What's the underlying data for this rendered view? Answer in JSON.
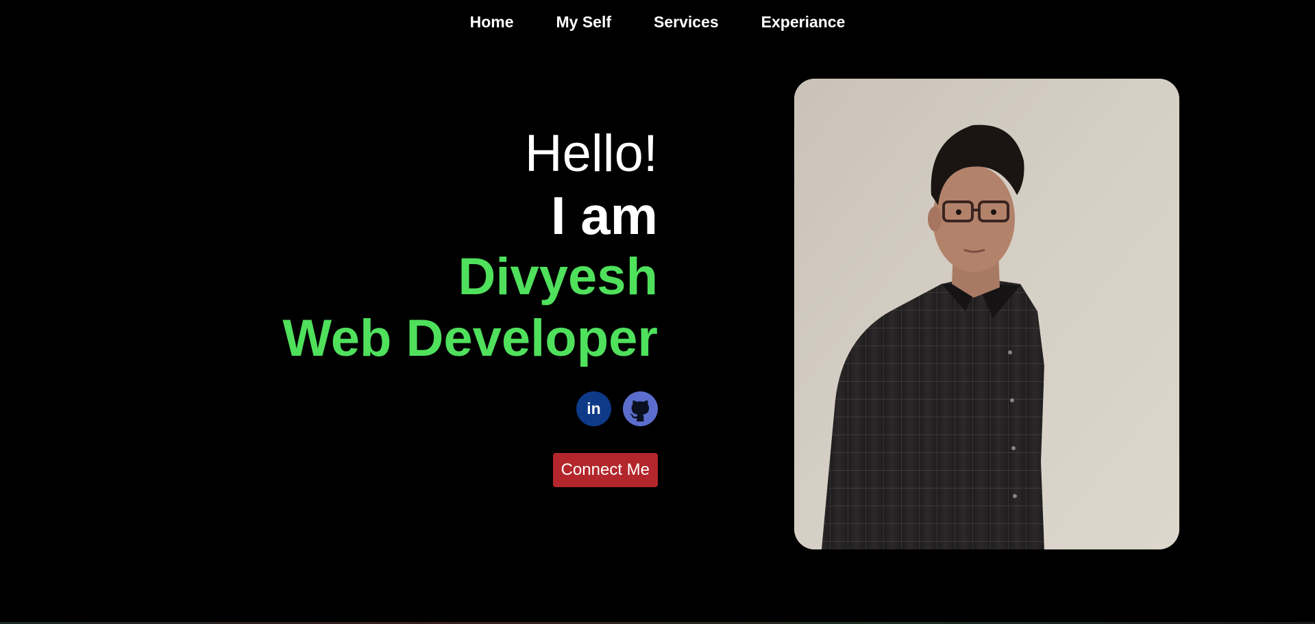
{
  "nav": {
    "items": [
      {
        "label": "Home"
      },
      {
        "label": "My Self"
      },
      {
        "label": "Services"
      },
      {
        "label": "Experiance"
      }
    ]
  },
  "hero": {
    "greeting": "Hello!",
    "intro": "I am",
    "name": "Divyesh",
    "role": "Web Developer"
  },
  "socials": [
    {
      "icon": "linkedin-icon",
      "glyph": "in",
      "color": "#0e3a88"
    },
    {
      "icon": "github-icon",
      "color": "#5b6ecd"
    }
  ],
  "cta": {
    "label": "Connect Me",
    "color": "#b3272c"
  },
  "colors": {
    "background": "#000000",
    "accent": "#4fe05c",
    "text": "#ffffff"
  }
}
